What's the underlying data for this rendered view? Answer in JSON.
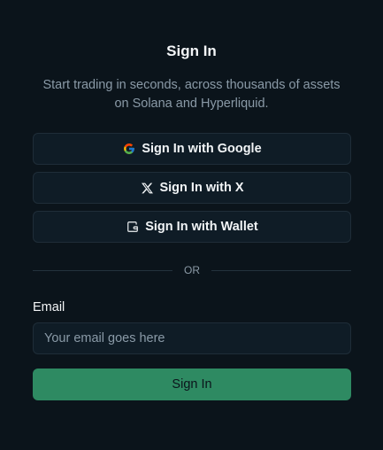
{
  "header": {
    "title": "Sign In",
    "subtitle": "Start trading in seconds, across thousands of assets on Solana and Hyperliquid."
  },
  "oauth": {
    "google": {
      "label": "Sign In with Google",
      "icon": "google-icon"
    },
    "x": {
      "label": "Sign In with X",
      "icon": "x-logo-icon"
    },
    "wallet": {
      "label": "Sign In with Wallet",
      "icon": "wallet-icon"
    }
  },
  "divider": {
    "text": "OR"
  },
  "email": {
    "label": "Email",
    "value": "",
    "placeholder": "Your email goes here"
  },
  "submit": {
    "label": "Sign In"
  },
  "colors": {
    "background": "#0b141b",
    "button_bg": "#0f1c26",
    "border": "#1f2d38",
    "primary": "#2e8a62",
    "muted_text": "#8a9aa7"
  }
}
